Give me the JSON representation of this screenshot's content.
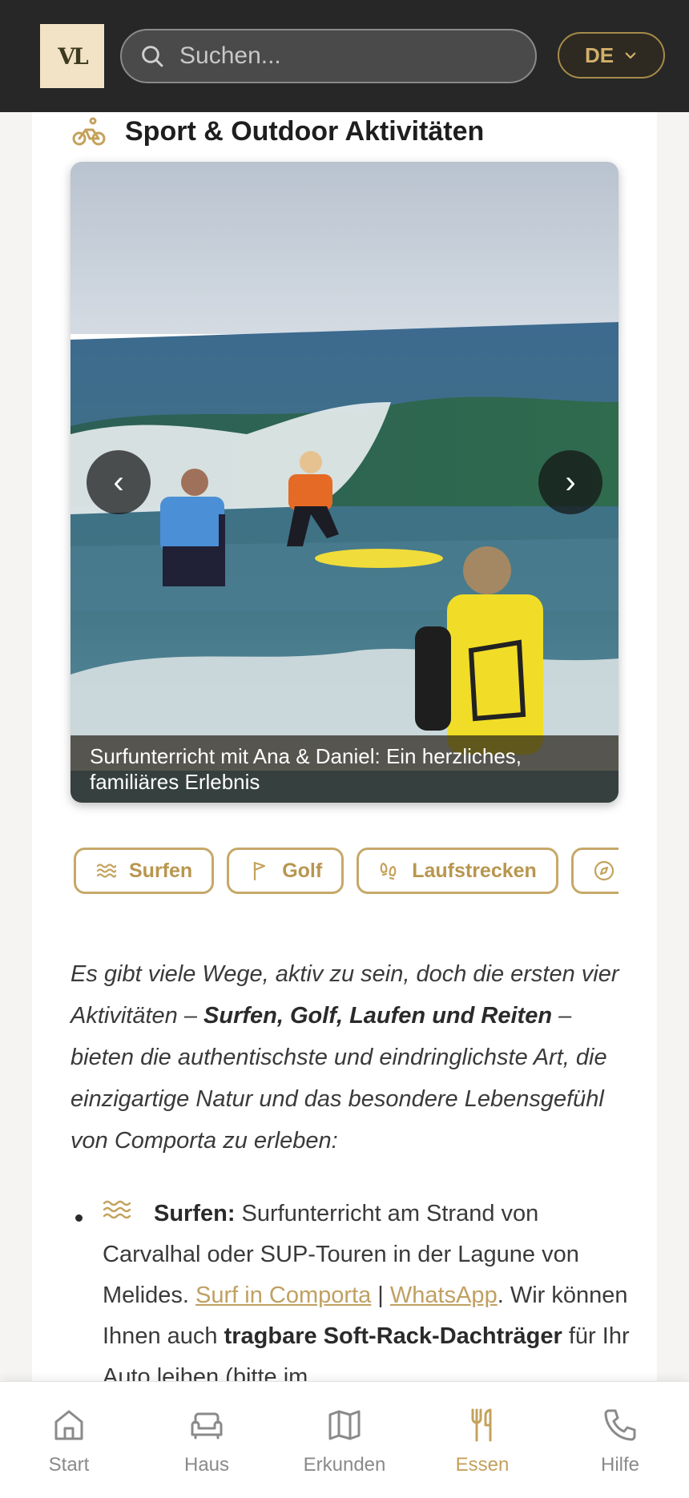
{
  "header": {
    "logo_text": "VL",
    "search_placeholder": "Suchen...",
    "language": "DE"
  },
  "section": {
    "title": "Sport & Outdoor Aktivitäten",
    "icon": "bicycle-icon"
  },
  "carousel": {
    "caption": "Surfunterricht mit Ana & Daniel: Ein herzliches, familiäres Erlebnis",
    "prev_label": "‹",
    "next_label": "›"
  },
  "chips": [
    {
      "label": "Surfen",
      "icon": "waves-icon"
    },
    {
      "label": "Golf",
      "icon": "flag-icon"
    },
    {
      "label": "Laufstrecken",
      "icon": "footprints-icon"
    },
    {
      "label": "",
      "icon": "compass-icon"
    }
  ],
  "intro": {
    "part1": "Es gibt viele Wege, aktiv zu sein, doch die ersten vier Aktivitäten – ",
    "bold": "Surfen, Golf, Laufen und Reiten",
    "part2": " – bieten die authentischste und eindringlichste Art, die einzigartige Natur und das besondere Lebensgefühl von Comporta zu erleben:"
  },
  "list": {
    "item1": {
      "heading": "Surfen:",
      "text1": " Surfunterricht am Strand von Carvalhal oder SUP-Touren in der Lagune von Melides. ",
      "link1": "Surf in Comporta",
      "sep": " | ",
      "link2": "WhatsApp",
      "text2": ". Wir können Ihnen auch ",
      "bold2": "tragbare Soft-Rack-Dachträger",
      "text3": " für Ihr Auto leihen (bitte im"
    }
  },
  "bottom_nav": [
    {
      "label": "Start",
      "icon": "home-icon",
      "active": false
    },
    {
      "label": "Haus",
      "icon": "sofa-icon",
      "active": false
    },
    {
      "label": "Erkunden",
      "icon": "map-icon",
      "active": false
    },
    {
      "label": "Essen",
      "icon": "utensils-icon",
      "active": true
    },
    {
      "label": "Hilfe",
      "icon": "phone-icon",
      "active": false
    }
  ],
  "colors": {
    "accent": "#c4a25c",
    "header_bg": "#272727"
  }
}
